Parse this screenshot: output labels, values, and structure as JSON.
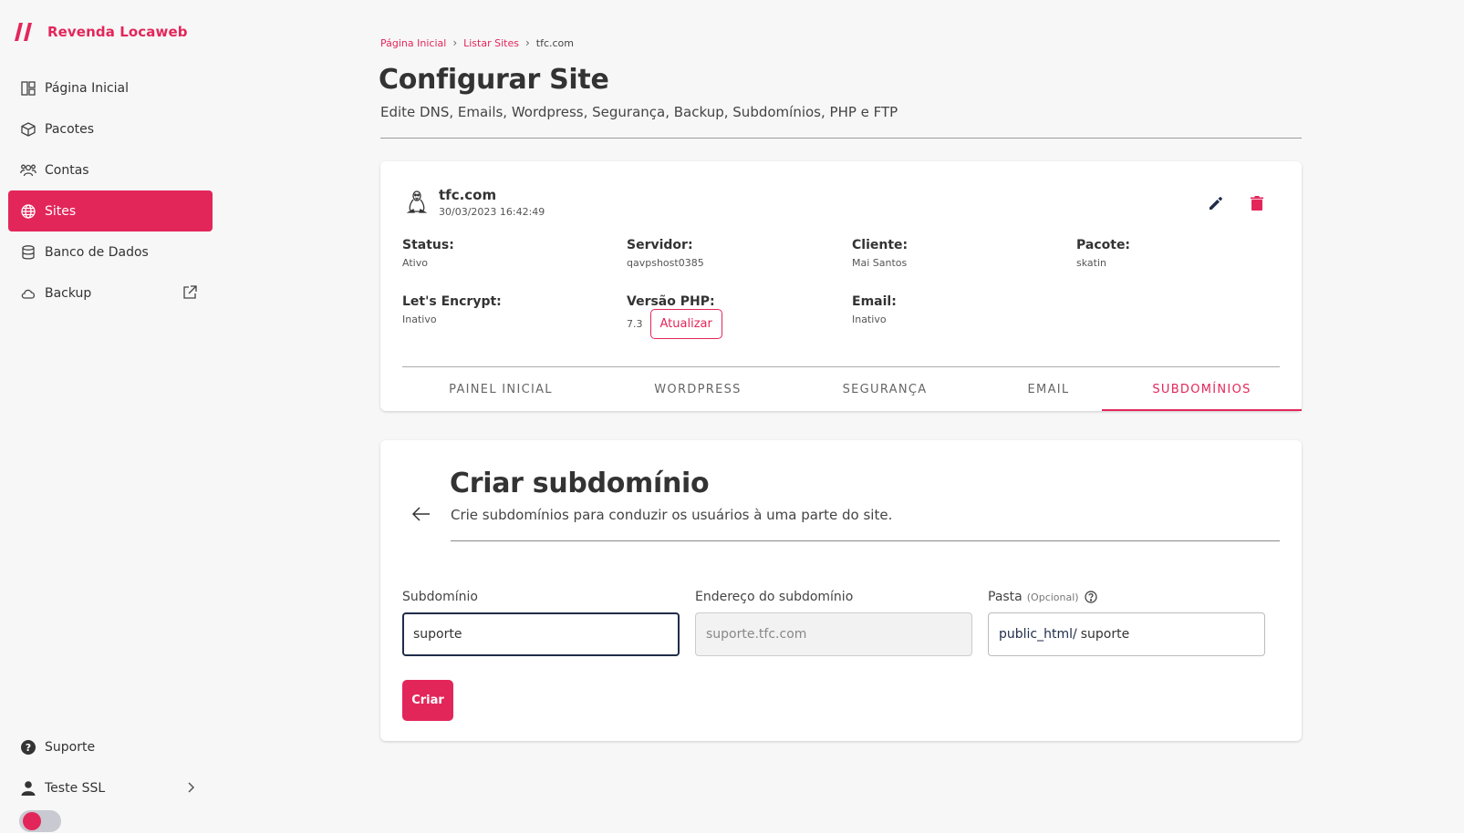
{
  "brand": {
    "name": "Revenda Locaweb"
  },
  "sidebar": {
    "items": [
      {
        "label": "Página Inicial",
        "icon": "dashboard-icon"
      },
      {
        "label": "Pacotes",
        "icon": "package-icon"
      },
      {
        "label": "Contas",
        "icon": "users-icon"
      },
      {
        "label": "Sites",
        "icon": "globe-icon",
        "active": true
      },
      {
        "label": "Banco de Dados",
        "icon": "database-icon"
      },
      {
        "label": "Backup",
        "icon": "cloud-icon",
        "external": true
      }
    ],
    "bottom": [
      {
        "label": "Suporte",
        "icon": "help-icon"
      },
      {
        "label": "Teste SSL",
        "icon": "user-icon"
      }
    ],
    "theme_toggle_on": false
  },
  "breadcrumb": {
    "items": [
      "Página Inicial",
      "Listar Sites"
    ],
    "current": "tfc.com"
  },
  "header": {
    "title": "Configurar Site",
    "subtitle": "Edite DNS, Emails, Wordpress, Segurança, Backup, Subdomínios, PHP e FTP"
  },
  "site": {
    "name": "tfc.com",
    "date": "30/03/2023 16:42:49",
    "fields": {
      "status": {
        "label": "Status:",
        "value": "Ativo"
      },
      "servidor": {
        "label": "Servidor:",
        "value": "qavpshost0385"
      },
      "cliente": {
        "label": "Cliente:",
        "value": "Mai Santos"
      },
      "pacote": {
        "label": "Pacote:",
        "value": "skatin"
      },
      "letsencrypt": {
        "label": "Let's Encrypt:",
        "value": "Inativo"
      },
      "php": {
        "label": "Versão PHP:",
        "value": "7.3",
        "button": "Atualizar"
      },
      "email": {
        "label": "Email:",
        "value": "Inativo"
      }
    }
  },
  "tabs": [
    {
      "label": "PAINEL INICIAL"
    },
    {
      "label": "WORDPRESS"
    },
    {
      "label": "SEGURANÇA"
    },
    {
      "label": "EMAIL"
    },
    {
      "label": "SUBDOMÍNIOS",
      "active": true
    }
  ],
  "subdomain": {
    "title": "Criar subdomínio",
    "description": "Crie subdomínios para conduzir os usuários à uma parte do site.",
    "fields": {
      "subdominio": {
        "label": "Subdomínio",
        "value": "suporte"
      },
      "endereco": {
        "label": "Endereço do subdomínio",
        "value": "suporte.tfc.com"
      },
      "pasta": {
        "label": "Pasta",
        "optional": "(Opcional)",
        "prefix": "public_html/",
        "value": "suporte"
      }
    },
    "create_label": "Criar"
  },
  "colors": {
    "accent": "#e3265a",
    "focus": "#1f2d4a"
  }
}
